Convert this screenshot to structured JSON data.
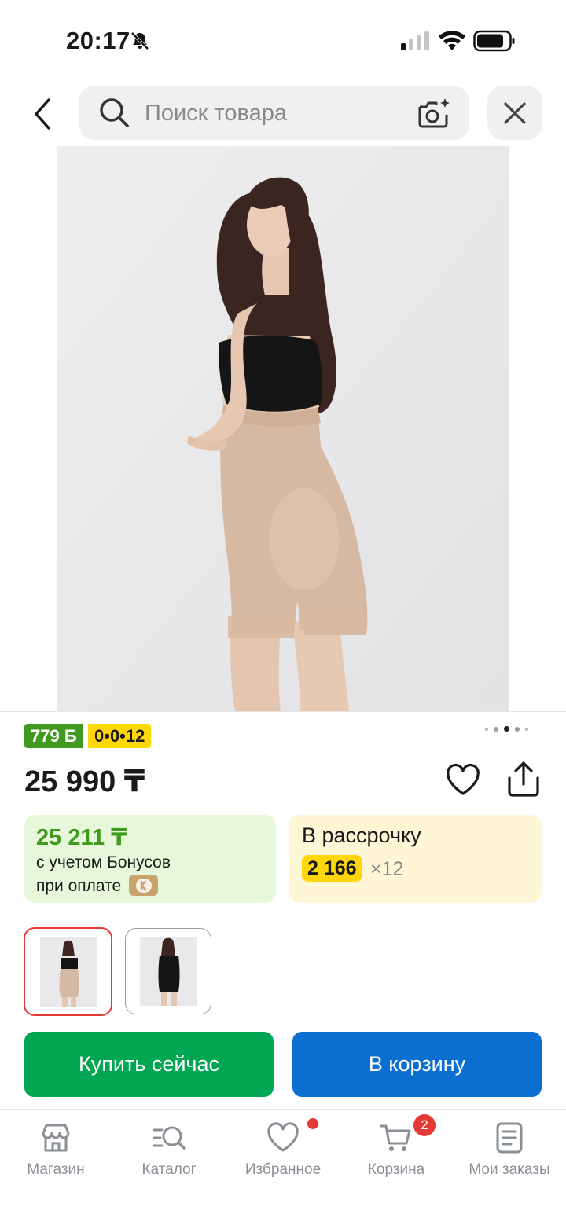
{
  "status_bar": {
    "time": "20:17"
  },
  "search": {
    "placeholder": "Поиск товара"
  },
  "badges": {
    "bonus": "779 Б",
    "installment": "0•0•12"
  },
  "gallery": {
    "total": 5,
    "active_index": 2
  },
  "product": {
    "price": "25 990 ₸"
  },
  "bonus_card": {
    "price": "25 211 ₸",
    "line1": "с учетом Бонусов",
    "line2": "при оплате"
  },
  "installment_card": {
    "title": "В рассрочку",
    "amount": "2 166",
    "times": "×12"
  },
  "actions": {
    "buy_now": "Купить сейчас",
    "add_to_cart": "В корзину"
  },
  "nav": {
    "items": [
      {
        "label": "Магазин",
        "icon": "shop-icon"
      },
      {
        "label": "Каталог",
        "icon": "catalog-search-icon"
      },
      {
        "label": "Избранное",
        "icon": "heart-icon",
        "dot": true
      },
      {
        "label": "Корзина",
        "icon": "cart-icon",
        "count": "2"
      },
      {
        "label": "Мои заказы",
        "icon": "orders-icon"
      }
    ]
  },
  "colors": {
    "green": "#00a651",
    "blue": "#0b6fd1",
    "bonus_green": "#3f9a1f",
    "yellow": "#ffd60a",
    "red": "#e53935"
  }
}
